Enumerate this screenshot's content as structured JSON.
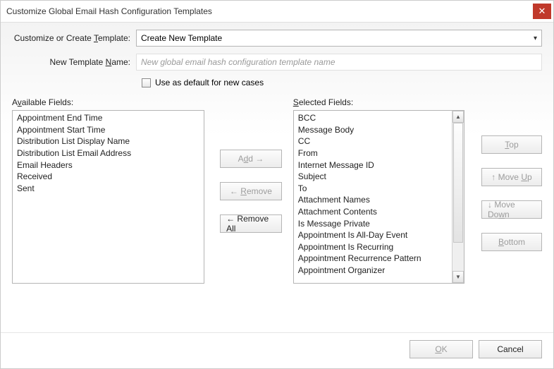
{
  "title": "Customize Global Email Hash Configuration Templates",
  "form": {
    "template_label_pre": "Customize or Create ",
    "template_label_u": "T",
    "template_label_post": "emplate:",
    "template_value": "Create New Template",
    "name_label_pre": "New Template ",
    "name_label_u": "N",
    "name_label_post": "ame:",
    "name_placeholder": "New global email hash configuration template name",
    "default_checkbox": "Use as default for new cases"
  },
  "available": {
    "label_pre": "A",
    "label_u": "v",
    "label_post": "ailable Fields:",
    "items": [
      "Appointment End Time",
      "Appointment Start Time",
      "Distribution List Display Name",
      "Distribution List Email Address",
      "Email Headers",
      "Received",
      "Sent"
    ]
  },
  "mid": {
    "add_pre": "A",
    "add_u": "d",
    "add_post": "d →",
    "remove_arrow": "← ",
    "remove_u": "R",
    "remove_post": "emove",
    "remove_all": "← Remove All"
  },
  "selected": {
    "label_pre": "",
    "label_u": "S",
    "label_post": "elected Fields:",
    "items": [
      "BCC",
      "Message Body",
      "CC",
      "From",
      "Internet Message ID",
      "Subject",
      "To",
      "Attachment Names",
      "Attachment Contents",
      "Is Message Private",
      "Appointment Is All-Day Event",
      "Appointment Is Recurring",
      "Appointment Recurrence Pattern",
      "Appointment Organizer"
    ]
  },
  "reorder": {
    "top_u": "T",
    "top_post": "op",
    "up_pre": "↑ Move ",
    "up_u": "U",
    "up_post": "p",
    "down_pre": "↓ Move Do",
    "down_u": "w",
    "down_post": "n",
    "bottom_u": "B",
    "bottom_post": "ottom"
  },
  "footer": {
    "ok_u": "O",
    "ok_post": "K",
    "cancel": "Cancel"
  }
}
